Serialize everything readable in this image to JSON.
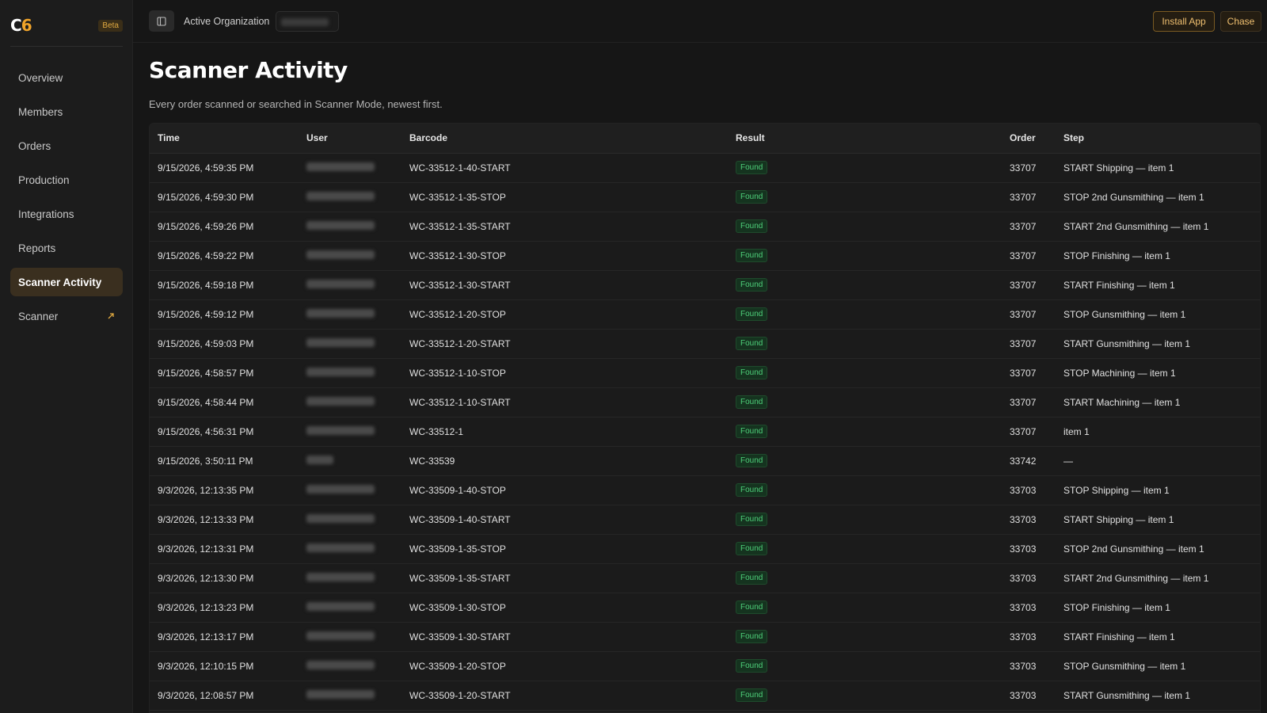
{
  "brand": {
    "logo_c": "C",
    "logo_6": "6",
    "badge": "Beta",
    "accent": "#f0a42a"
  },
  "sidebar": {
    "items": [
      {
        "label": "Overview",
        "active": false
      },
      {
        "label": "Members",
        "active": false
      },
      {
        "label": "Orders",
        "active": false
      },
      {
        "label": "Production",
        "active": false
      },
      {
        "label": "Integrations",
        "active": false
      },
      {
        "label": "Reports",
        "active": false
      },
      {
        "label": "Scanner Activity",
        "active": true
      },
      {
        "label": "Scanner",
        "active": false,
        "icon": "external-link-icon"
      }
    ]
  },
  "topbar": {
    "org_label": "Active Organization",
    "install_label": "Install App",
    "user_label": "Chase"
  },
  "page": {
    "title": "Scanner Activity",
    "subtitle": "Every order scanned or searched in Scanner Mode, newest first."
  },
  "table": {
    "columns": [
      "Time",
      "User",
      "Barcode",
      "Result",
      "Order",
      "Step"
    ],
    "rows": [
      {
        "time": "9/15/2026, 4:59:35 PM",
        "barcode": "WC-33512-1-40-START",
        "result": "Found",
        "order": "33707",
        "step": "START Shipping — item 1"
      },
      {
        "time": "9/15/2026, 4:59:30 PM",
        "barcode": "WC-33512-1-35-STOP",
        "result": "Found",
        "order": "33707",
        "step": "STOP 2nd Gunsmithing — item 1"
      },
      {
        "time": "9/15/2026, 4:59:26 PM",
        "barcode": "WC-33512-1-35-START",
        "result": "Found",
        "order": "33707",
        "step": "START 2nd Gunsmithing — item 1"
      },
      {
        "time": "9/15/2026, 4:59:22 PM",
        "barcode": "WC-33512-1-30-STOP",
        "result": "Found",
        "order": "33707",
        "step": "STOP Finishing — item 1"
      },
      {
        "time": "9/15/2026, 4:59:18 PM",
        "barcode": "WC-33512-1-30-START",
        "result": "Found",
        "order": "33707",
        "step": "START Finishing — item 1"
      },
      {
        "time": "9/15/2026, 4:59:12 PM",
        "barcode": "WC-33512-1-20-STOP",
        "result": "Found",
        "order": "33707",
        "step": "STOP Gunsmithing — item 1"
      },
      {
        "time": "9/15/2026, 4:59:03 PM",
        "barcode": "WC-33512-1-20-START",
        "result": "Found",
        "order": "33707",
        "step": "START Gunsmithing — item 1"
      },
      {
        "time": "9/15/2026, 4:58:57 PM",
        "barcode": "WC-33512-1-10-STOP",
        "result": "Found",
        "order": "33707",
        "step": "STOP Machining — item 1"
      },
      {
        "time": "9/15/2026, 4:58:44 PM",
        "barcode": "WC-33512-1-10-START",
        "result": "Found",
        "order": "33707",
        "step": "START Machining — item 1"
      },
      {
        "time": "9/15/2026, 4:56:31 PM",
        "barcode": "WC-33512-1",
        "result": "Found",
        "order": "33707",
        "step": "item 1"
      },
      {
        "time": "9/15/2026, 3:50:11 PM",
        "barcode": "WC-33539",
        "result": "Found",
        "order": "33742",
        "step": "—",
        "short_user": true
      },
      {
        "time": "9/3/2026, 12:13:35 PM",
        "barcode": "WC-33509-1-40-STOP",
        "result": "Found",
        "order": "33703",
        "step": "STOP Shipping — item 1"
      },
      {
        "time": "9/3/2026, 12:13:33 PM",
        "barcode": "WC-33509-1-40-START",
        "result": "Found",
        "order": "33703",
        "step": "START Shipping — item 1"
      },
      {
        "time": "9/3/2026, 12:13:31 PM",
        "barcode": "WC-33509-1-35-STOP",
        "result": "Found",
        "order": "33703",
        "step": "STOP 2nd Gunsmithing — item 1"
      },
      {
        "time": "9/3/2026, 12:13:30 PM",
        "barcode": "WC-33509-1-35-START",
        "result": "Found",
        "order": "33703",
        "step": "START 2nd Gunsmithing — item 1"
      },
      {
        "time": "9/3/2026, 12:13:23 PM",
        "barcode": "WC-33509-1-30-STOP",
        "result": "Found",
        "order": "33703",
        "step": "STOP Finishing — item 1"
      },
      {
        "time": "9/3/2026, 12:13:17 PM",
        "barcode": "WC-33509-1-30-START",
        "result": "Found",
        "order": "33703",
        "step": "START Finishing — item 1"
      },
      {
        "time": "9/3/2026, 12:10:15 PM",
        "barcode": "WC-33509-1-20-STOP",
        "result": "Found",
        "order": "33703",
        "step": "STOP Gunsmithing — item 1"
      },
      {
        "time": "9/3/2026, 12:08:57 PM",
        "barcode": "WC-33509-1-20-START",
        "result": "Found",
        "order": "33703",
        "step": "START Gunsmithing — item 1"
      }
    ]
  }
}
